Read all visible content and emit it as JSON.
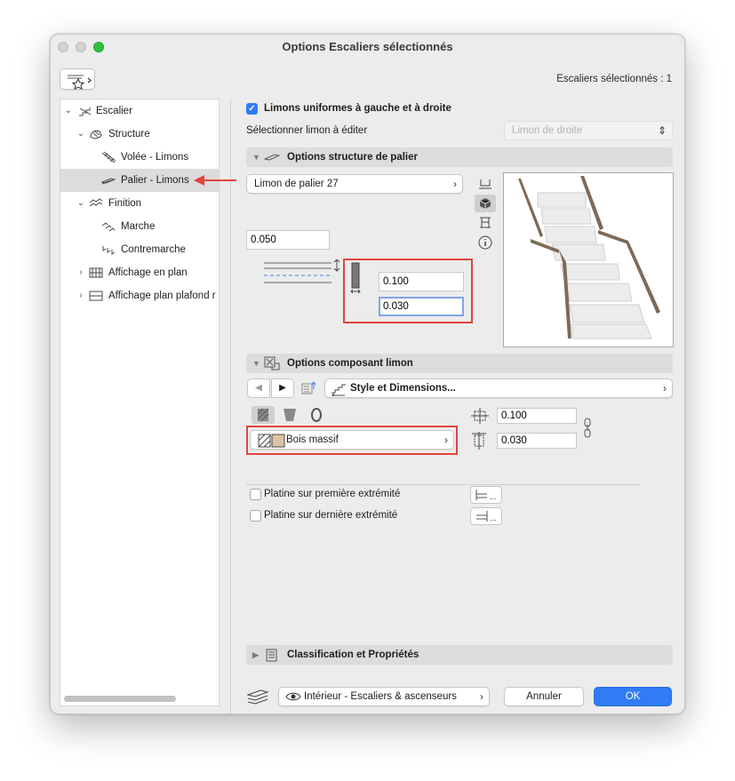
{
  "window": {
    "title": "Options Escaliers sélectionnés",
    "selection_count": "Escaliers sélectionnés : 1"
  },
  "tree": {
    "items": [
      {
        "label": "Escalier",
        "icon": "stair-icon"
      },
      {
        "label": "Structure",
        "icon": "structure-icon"
      },
      {
        "label": "Volée - Limons",
        "icon": "flight-stringers-icon"
      },
      {
        "label": "Palier - Limons",
        "icon": "landing-stringers-icon"
      },
      {
        "label": "Finition",
        "icon": "finish-icon"
      },
      {
        "label": "Marche",
        "icon": "tread-icon"
      },
      {
        "label": "Contremarche",
        "icon": "riser-icon"
      },
      {
        "label": "Affichage en plan",
        "icon": "floor-plan-icon"
      },
      {
        "label": "Affichage plan plafond r",
        "icon": "ceiling-plan-icon"
      }
    ]
  },
  "top_options": {
    "uniform_label": "Limons uniformes à gauche et à droite",
    "uniform_checked": true,
    "select_label": "Sélectionner limon à éditer",
    "select_value": "Limon de droite"
  },
  "landing_section": {
    "title": "Options structure de palier",
    "profile": "Limon de palier 27",
    "offset": "0.050",
    "height": "0.100",
    "thickness": "0.030"
  },
  "component_section": {
    "title": "Options composant limon",
    "style_label": "Style et Dimensions...",
    "material": "Bois massif",
    "width": "0.100",
    "depth": "0.030"
  },
  "plates": {
    "first": "Platine sur première extrémité",
    "last": "Platine sur dernière extrémité",
    "ellipsis": "..."
  },
  "classification": {
    "title": "Classification et Propriétés"
  },
  "footer": {
    "layer": "Intérieur - Escaliers & ascenseurs",
    "cancel": "Annuler",
    "ok": "OK"
  },
  "colors": {
    "accent": "#2f7cf6",
    "highlight": "#e2453b",
    "rail": "#7d6a57"
  }
}
